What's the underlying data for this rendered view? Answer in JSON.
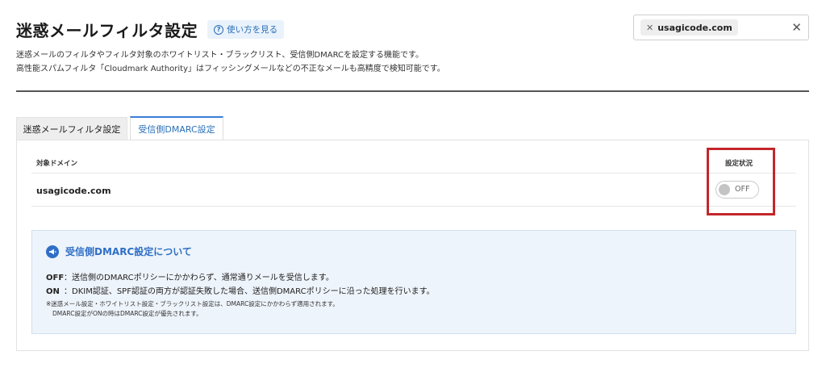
{
  "header": {
    "title": "迷惑メールフィルタ設定",
    "help_label": "使い方を見る"
  },
  "domain_selector": {
    "selected": "usagicode.com"
  },
  "description": {
    "line1": "迷惑メールのフィルタやフィルタ対象のホワイトリスト・ブラックリスト、受信側DMARCを設定する機能です。",
    "line2": "高性能スパムフィルタ「Cloudmark Authority」はフィッシングメールなどの不正なメールも高精度で検知可能です。"
  },
  "tabs": [
    {
      "label": "迷惑メールフィルタ設定",
      "active": false
    },
    {
      "label": "受信側DMARC設定",
      "active": true
    }
  ],
  "table": {
    "col_domain": "対象ドメイン",
    "col_status": "設定状況",
    "rows": [
      {
        "domain": "usagicode.com",
        "status": "OFF"
      }
    ]
  },
  "info": {
    "title": "受信側DMARC設定について",
    "off_key": "OFF",
    "off_text": "：送信側のDMARCポリシーにかかわらず、通常通りメールを受信します。",
    "on_key": "ON",
    "on_text": "：DKIM認証、SPF認証の両方が認証失敗した場合、送信側DMARCポリシーに沿った処理を行います。",
    "note1": "※迷惑メール設定・ホワイトリスト設定・ブラックリスト設定は、DMARC設定にかかわらず適用されます。",
    "note2": "DMARC設定がONの時はDMARC設定が優先されます。"
  },
  "colors": {
    "accent": "#2a6fb8",
    "highlight": "#c3272b",
    "info_bg": "#eef4fb"
  },
  "icons": [
    "help-circle-icon",
    "close-icon",
    "megaphone-icon"
  ]
}
